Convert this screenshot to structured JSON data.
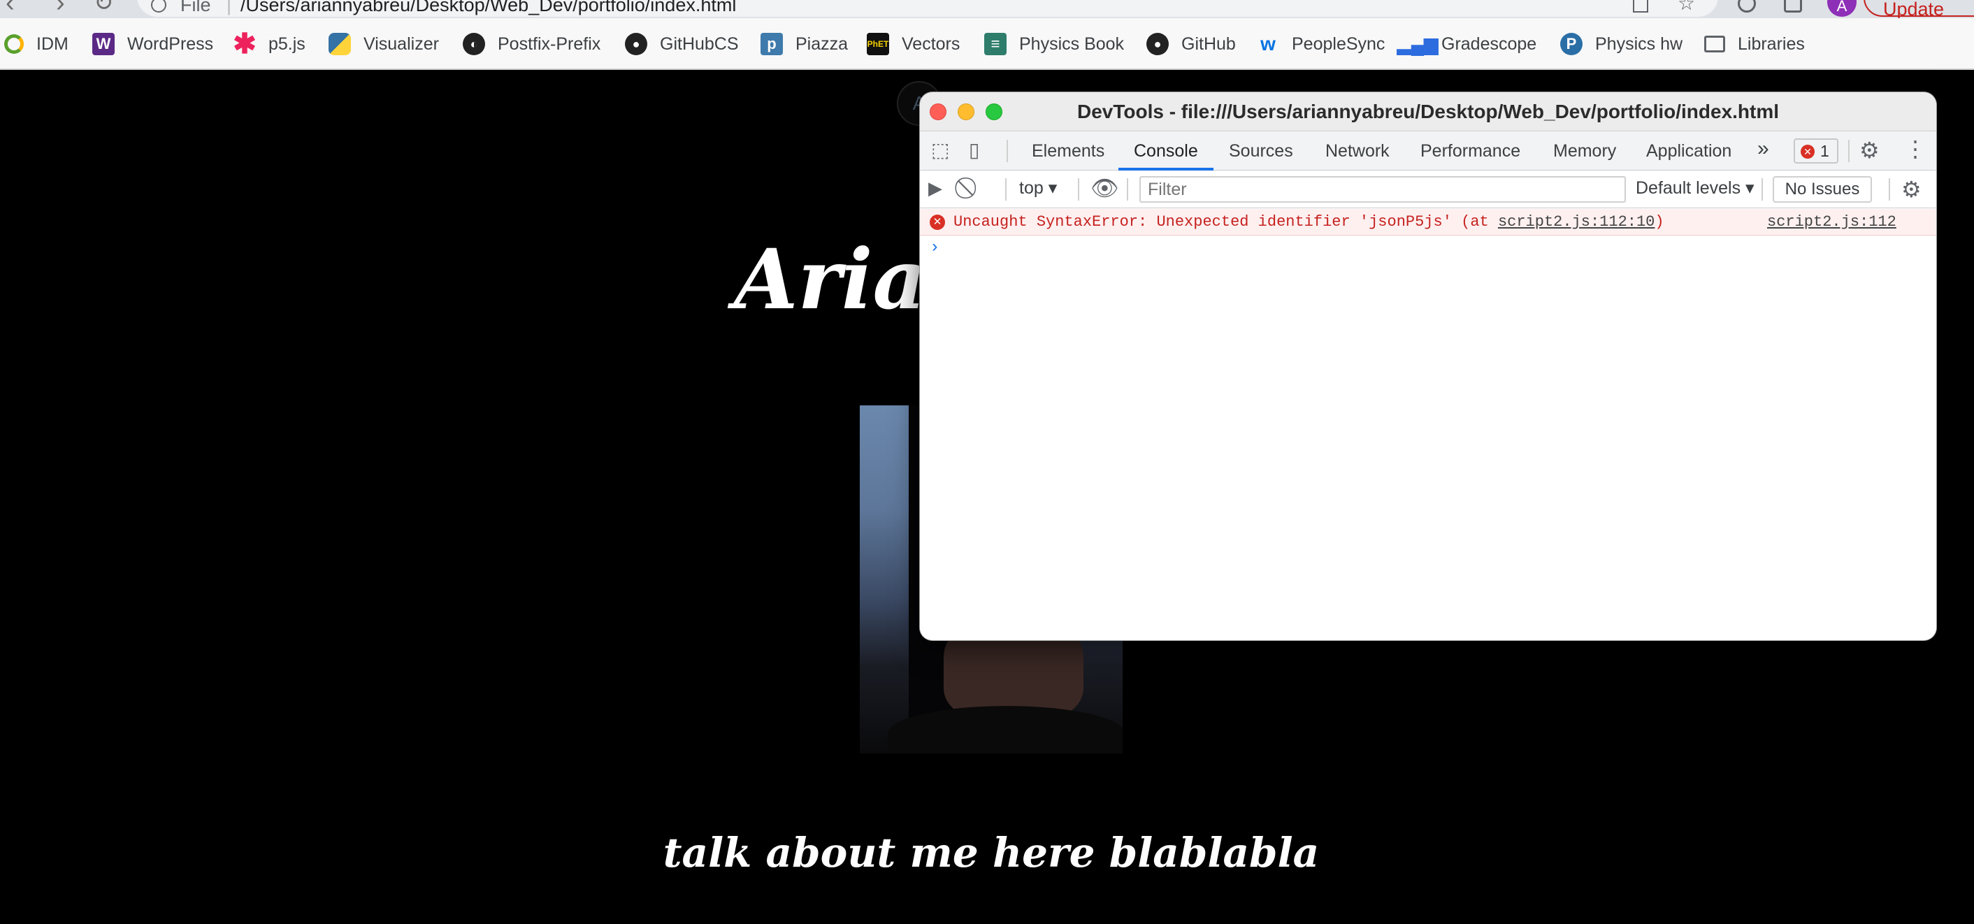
{
  "browser": {
    "scheme": "File",
    "url": "/Users/ariannyabreu/Desktop/Web_Dev/portfolio/index.html",
    "profile_initial": "A",
    "update_label": "Update"
  },
  "bookmarks": [
    {
      "label": "IDM",
      "icon": "idm-ring-icon",
      "color": "#5aa02c"
    },
    {
      "label": "WordPress",
      "icon": "wordpress-icon",
      "color": "#5b2a86"
    },
    {
      "label": "p5.js",
      "icon": "p5-asterisk-icon",
      "color": "#ed225d"
    },
    {
      "label": "Visualizer",
      "icon": "python-icon",
      "color": "#3572a5"
    },
    {
      "label": "Postfix-Prefix",
      "icon": "globe-icon",
      "color": "#222222"
    },
    {
      "label": "GitHubCS",
      "icon": "github-icon",
      "color": "#222222"
    },
    {
      "label": "Piazza",
      "icon": "piazza-icon",
      "color": "#3e7aab"
    },
    {
      "label": "Vectors",
      "icon": "phet-icon",
      "color": "#111111"
    },
    {
      "label": "Physics Book",
      "icon": "book-icon",
      "color": "#2e7d6b"
    },
    {
      "label": "GitHub",
      "icon": "github-icon",
      "color": "#222222"
    },
    {
      "label": "PeopleSync",
      "icon": "workday-icon",
      "color": "#0875e1"
    },
    {
      "label": "Gradescope",
      "icon": "bar-chart-icon",
      "color": "#2d6cdf"
    },
    {
      "label": "Physics hw",
      "icon": "pearson-icon",
      "color": "#2a6ea6"
    },
    {
      "label": "Libraries",
      "icon": "folder-icon",
      "color": "#5f6368"
    }
  ],
  "page": {
    "hero_title": "Arian",
    "avatar_initial": "A",
    "about_text": "talk about me here blablabla"
  },
  "devtools": {
    "title": "DevTools - file:///Users/ariannyabreu/Desktop/Web_Dev/portfolio/index.html",
    "tabs": [
      "Elements",
      "Console",
      "Sources",
      "Network",
      "Performance",
      "Memory",
      "Application"
    ],
    "active_tab": "Console",
    "overflow": "»",
    "error_count": "1",
    "context": "top",
    "filter_placeholder": "Filter",
    "levels": "Default levels",
    "no_issues": "No Issues",
    "error": {
      "message": "Uncaught SyntaxError: Unexpected identifier 'jsonP5js' (at ",
      "link": "script2.js:112:10",
      "close": ")",
      "source": "script2.js:112"
    },
    "prompt": "›"
  }
}
